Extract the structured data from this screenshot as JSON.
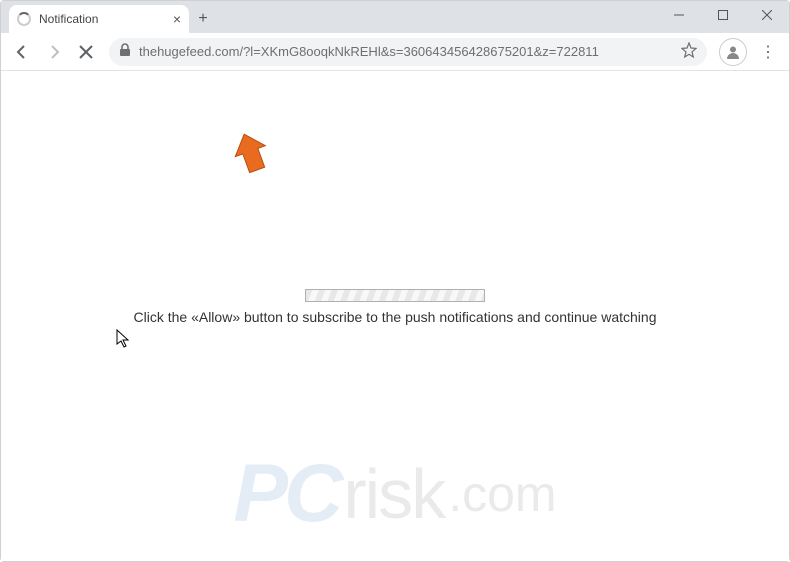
{
  "window": {
    "tab_title": "Notification"
  },
  "toolbar": {
    "url": "thehugefeed.com/?l=XKmG8ooqkNkREHl&s=360643456428675201&z=722811"
  },
  "page": {
    "message": "Click the «Allow» button to subscribe to the push notifications and continue watching"
  },
  "watermark": {
    "pc": "PC",
    "risk": "risk",
    "com": ".com"
  }
}
